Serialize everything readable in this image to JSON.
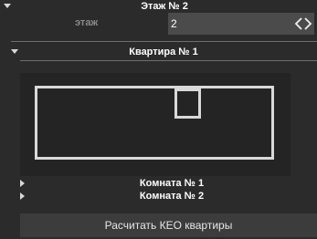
{
  "floor": {
    "title": "Этаж № 2",
    "field_label": "этаж",
    "field_value": "2",
    "stepper_prev": "‹",
    "stepper_next": "›"
  },
  "apartment": {
    "title": "Квартира № 1"
  },
  "rooms": [
    {
      "label": "Комната № 1"
    },
    {
      "label": "Комната № 2"
    }
  ],
  "actions": {
    "calculate_label": "Расчитать КЕО квартиры"
  }
}
